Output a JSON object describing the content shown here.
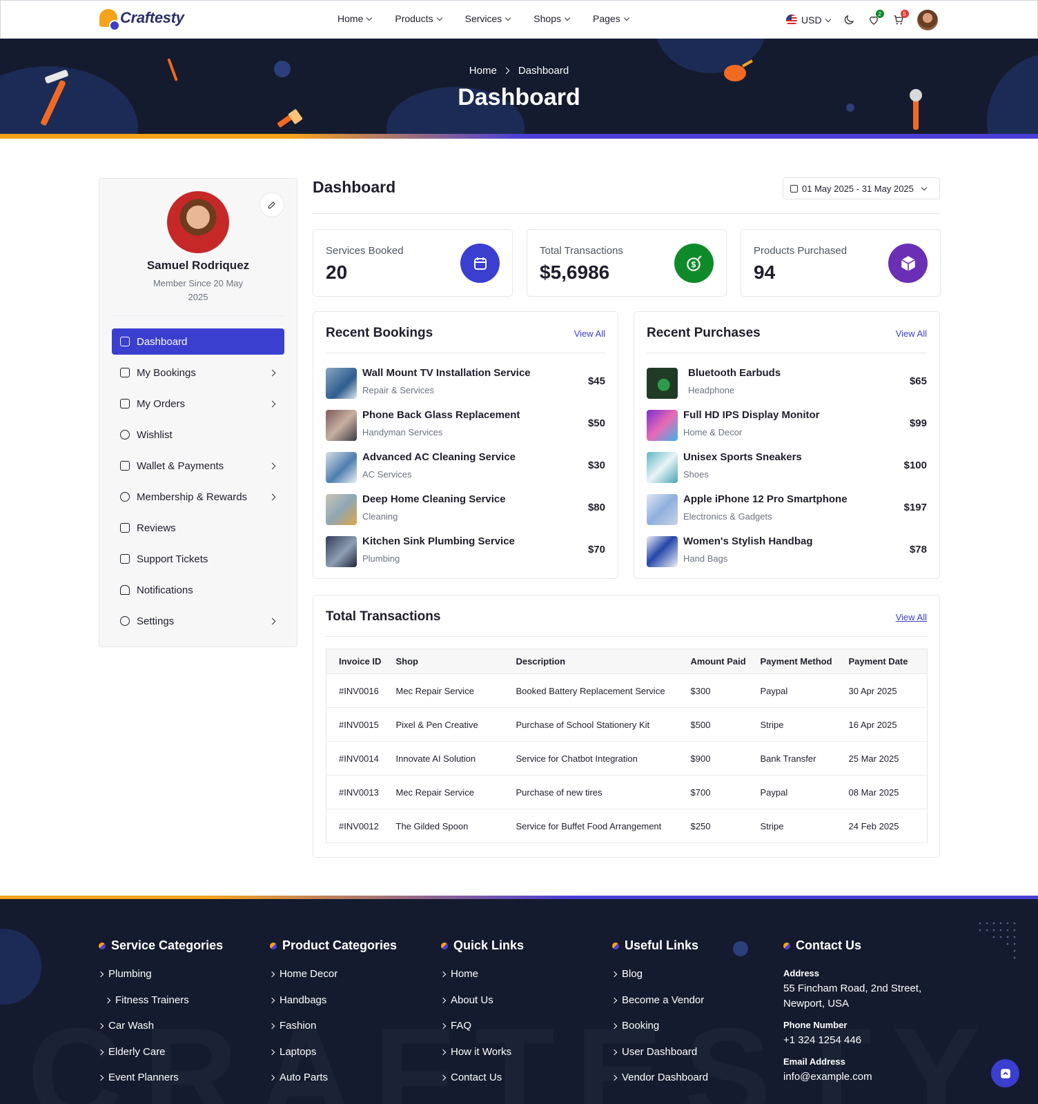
{
  "brand": {
    "name": "Craftesty"
  },
  "nav": {
    "items": [
      {
        "label": "Home"
      },
      {
        "label": "Products"
      },
      {
        "label": "Services"
      },
      {
        "label": "Shops"
      },
      {
        "label": "Pages"
      }
    ],
    "currency": "USD",
    "wishlist_count": "2",
    "cart_count": "5"
  },
  "hero": {
    "breadcrumb": [
      "Home",
      "Dashboard"
    ],
    "title": "Dashboard"
  },
  "profile": {
    "name": "Samuel Rodriquez",
    "member_since": "Member Since 20 May 2025"
  },
  "sidebar": {
    "items": [
      {
        "label": "Dashboard",
        "icon": "home-icon"
      },
      {
        "label": "My Bookings",
        "icon": "calendar-icon"
      },
      {
        "label": "My Orders",
        "icon": "cart-icon"
      },
      {
        "label": "Wishlist",
        "icon": "heart-icon"
      },
      {
        "label": "Wallet & Payments",
        "icon": "wallet-icon"
      },
      {
        "label": "Membership & Rewards",
        "icon": "award-icon"
      },
      {
        "label": "Reviews",
        "icon": "star-icon"
      },
      {
        "label": "Support Tickets",
        "icon": "ticket-icon"
      },
      {
        "label": "Notifications",
        "icon": "bell-icon"
      },
      {
        "label": "Settings",
        "icon": "gear-icon"
      }
    ]
  },
  "main": {
    "title": "Dashboard",
    "date_range": "01 May 2025 - 31 May 2025"
  },
  "stats": [
    {
      "label": "Services Booked",
      "value": "20",
      "color": "#3a3fd0"
    },
    {
      "label": "Total Transactions",
      "value": "$5,6986",
      "color": "#0f8a2a"
    },
    {
      "label": "Products Purchased",
      "value": "94",
      "color": "#6a2fb5"
    }
  ],
  "recent_bookings": {
    "title": "Recent Bookings",
    "view_all": "View All",
    "items": [
      {
        "name": "Wall Mount TV Installation Service",
        "category": "Repair & Services",
        "price": "$45"
      },
      {
        "name": "Phone Back Glass Replacement",
        "category": "Handyman Services",
        "price": "$50"
      },
      {
        "name": "Advanced AC Cleaning Service",
        "category": "AC Services",
        "price": "$30"
      },
      {
        "name": "Deep Home Cleaning Service",
        "category": "Cleaning",
        "price": "$80"
      },
      {
        "name": "Kitchen Sink Plumbing Service",
        "category": "Plumbing",
        "price": "$70"
      }
    ]
  },
  "recent_purchases": {
    "title": "Recent Purchases",
    "view_all": "View All",
    "items": [
      {
        "name": "Bluetooth Earbuds",
        "category": "Headphone",
        "price": "$65"
      },
      {
        "name": "Full HD IPS Display Monitor",
        "category": "Home & Decor",
        "price": "$99"
      },
      {
        "name": "Unisex Sports Sneakers",
        "category": "Shoes",
        "price": "$100"
      },
      {
        "name": "Apple iPhone 12 Pro Smartphone",
        "category": "Electronics & Gadgets",
        "price": "$197"
      },
      {
        "name": "Women's Stylish Handbag",
        "category": "Hand Bags",
        "price": "$78"
      }
    ]
  },
  "transactions": {
    "title": "Total Transactions",
    "view_all": "View All",
    "headers": [
      "Invoice ID",
      "Shop",
      "Description",
      "Amount Paid",
      "Payment Method",
      "Payment Date"
    ],
    "rows": [
      [
        "#INV0016",
        "Mec Repair Service",
        "Booked Battery Replacement Service",
        "$300",
        "Paypal",
        "30 Apr 2025"
      ],
      [
        "#INV0015",
        "Pixel & Pen Creative",
        "Purchase of School Stationery Kit",
        "$500",
        "Stripe",
        "16 Apr 2025"
      ],
      [
        "#INV0014",
        "Innovate AI Solution",
        "Service for Chatbot Integration",
        "$900",
        "Bank Transfer",
        "25 Mar 2025"
      ],
      [
        "#INV0013",
        "Mec Repair Service",
        "Purchase of new tires",
        "$700",
        "Paypal",
        "08 Mar 2025"
      ],
      [
        "#INV0012",
        "The Gilded Spoon",
        "Service for Buffet Food Arrangement",
        "$250",
        "Stripe",
        "24 Feb 2025"
      ]
    ]
  },
  "footer": {
    "watermark": "CRAFTESTY",
    "service_categories": {
      "title": "Service Categories",
      "links": [
        "Plumbing",
        "Fitness Trainers",
        "Car Wash",
        "Elderly Care",
        "Event Planners"
      ]
    },
    "product_categories": {
      "title": "Product Categories",
      "links": [
        "Home Decor",
        "Handbags",
        "Fashion",
        "Laptops",
        "Auto Parts"
      ]
    },
    "quick_links": {
      "title": "Quick Links",
      "links": [
        "Home",
        "About Us",
        "FAQ",
        "How it Works",
        "Contact Us"
      ]
    },
    "useful_links": {
      "title": "Useful Links",
      "links": [
        "Blog",
        "Become a Vendor",
        "Booking",
        "User Dashboard",
        "Vendor Dashboard"
      ]
    },
    "contact": {
      "title": "Contact Us",
      "address_label": "Address",
      "address": "55 Fincham Road, 2nd Street, Newport,  USA",
      "phone_label": "Phone Number",
      "phone": "+1 324 1254 446",
      "email_label": "Email Address",
      "email": "info@example.com"
    }
  }
}
